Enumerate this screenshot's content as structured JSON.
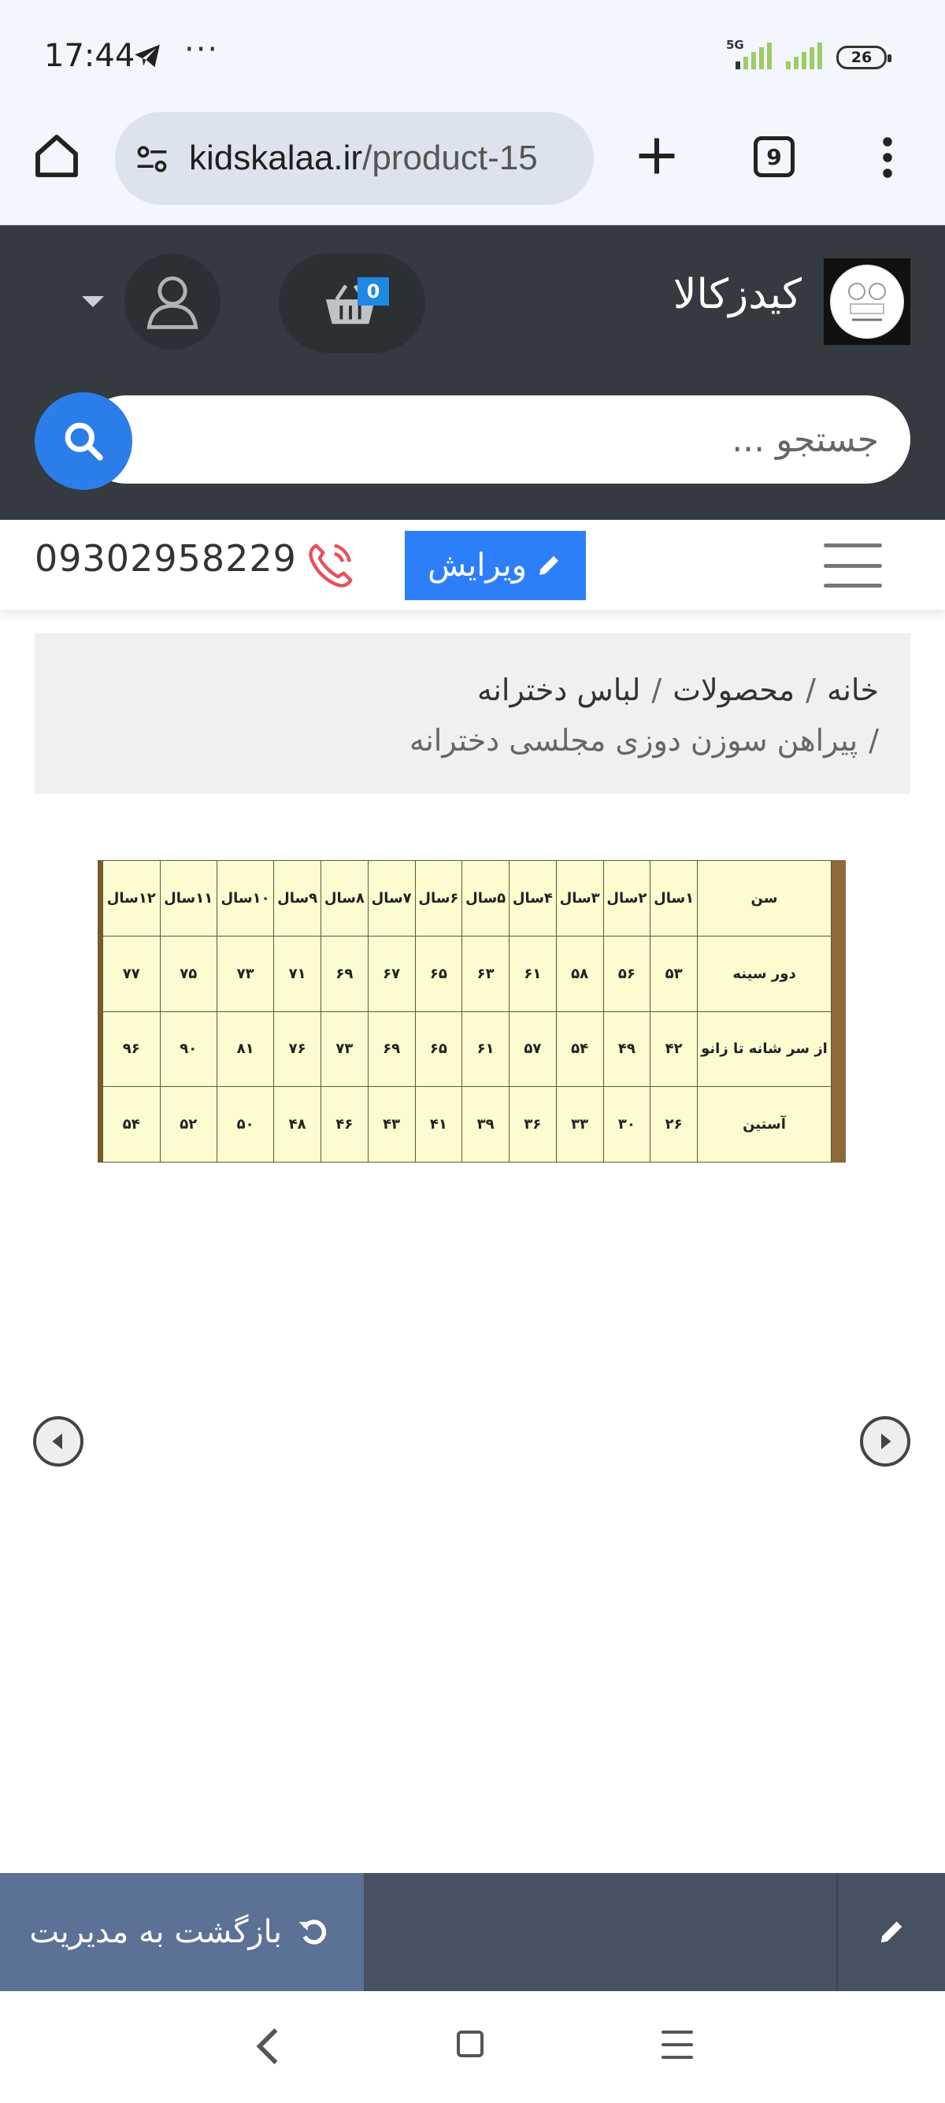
{
  "status_bar": {
    "time": "17:44",
    "more": "···",
    "network": "5G",
    "battery": "26"
  },
  "browser": {
    "url_host": "kidskalaa.ir",
    "url_path": "/product-15",
    "tab_count": "9"
  },
  "header": {
    "site_title": "کیدزکالا",
    "cart_count": "0",
    "search_placeholder": "جستجو ...",
    "colors": {
      "header_bg": "#343a40",
      "accent": "#2b7de9"
    }
  },
  "toolbar": {
    "phone": "09302958229",
    "edit_label": "ویرایش"
  },
  "breadcrumb": {
    "items": [
      "خانه",
      "محصولات",
      "لباس دخترانه"
    ],
    "current": "پیراهن سوزن دوزی مجلسی دخترانه",
    "separator": "/"
  },
  "size_chart": {
    "header_label": "سن",
    "ages": [
      "۱سال",
      "۲سال",
      "۳سال",
      "۴سال",
      "۵سال",
      "۶سال",
      "۷سال",
      "۸سال",
      "۹سال",
      "۱۰سال",
      "۱۱سال",
      "۱۲سال"
    ],
    "rows": [
      {
        "label": "دور سینه",
        "values": [
          "۵۳",
          "۵۶",
          "۵۸",
          "۶۱",
          "۶۳",
          "۶۵",
          "۶۷",
          "۶۹",
          "۷۱",
          "۷۳",
          "۷۵",
          "۷۷"
        ]
      },
      {
        "label": "از سر شانه تا زانو",
        "values": [
          "۴۲",
          "۴۹",
          "۵۴",
          "۵۷",
          "۶۱",
          "۶۵",
          "۶۹",
          "۷۳",
          "۷۶",
          "۸۱",
          "۹۰",
          "۹۶"
        ]
      },
      {
        "label": "آستین",
        "values": [
          "۲۶",
          "۳۰",
          "۳۳",
          "۳۶",
          "۳۹",
          "۴۱",
          "۴۳",
          "۴۶",
          "۴۸",
          "۵۰",
          "۵۲",
          "۵۴"
        ]
      }
    ]
  },
  "admin_bar": {
    "back_label": "بازگشت به مدیریت"
  }
}
